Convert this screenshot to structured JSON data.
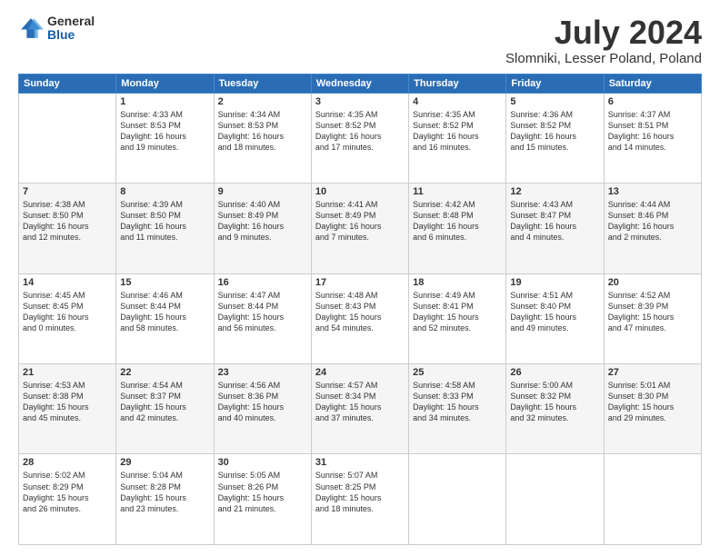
{
  "logo": {
    "general": "General",
    "blue": "Blue"
  },
  "title": "July 2024",
  "subtitle": "Slomniki, Lesser Poland, Poland",
  "days": [
    "Sunday",
    "Monday",
    "Tuesday",
    "Wednesday",
    "Thursday",
    "Friday",
    "Saturday"
  ],
  "weeks": [
    [
      {
        "num": "",
        "lines": []
      },
      {
        "num": "1",
        "lines": [
          "Sunrise: 4:33 AM",
          "Sunset: 8:53 PM",
          "Daylight: 16 hours",
          "and 19 minutes."
        ]
      },
      {
        "num": "2",
        "lines": [
          "Sunrise: 4:34 AM",
          "Sunset: 8:53 PM",
          "Daylight: 16 hours",
          "and 18 minutes."
        ]
      },
      {
        "num": "3",
        "lines": [
          "Sunrise: 4:35 AM",
          "Sunset: 8:52 PM",
          "Daylight: 16 hours",
          "and 17 minutes."
        ]
      },
      {
        "num": "4",
        "lines": [
          "Sunrise: 4:35 AM",
          "Sunset: 8:52 PM",
          "Daylight: 16 hours",
          "and 16 minutes."
        ]
      },
      {
        "num": "5",
        "lines": [
          "Sunrise: 4:36 AM",
          "Sunset: 8:52 PM",
          "Daylight: 16 hours",
          "and 15 minutes."
        ]
      },
      {
        "num": "6",
        "lines": [
          "Sunrise: 4:37 AM",
          "Sunset: 8:51 PM",
          "Daylight: 16 hours",
          "and 14 minutes."
        ]
      }
    ],
    [
      {
        "num": "7",
        "lines": [
          "Sunrise: 4:38 AM",
          "Sunset: 8:50 PM",
          "Daylight: 16 hours",
          "and 12 minutes."
        ]
      },
      {
        "num": "8",
        "lines": [
          "Sunrise: 4:39 AM",
          "Sunset: 8:50 PM",
          "Daylight: 16 hours",
          "and 11 minutes."
        ]
      },
      {
        "num": "9",
        "lines": [
          "Sunrise: 4:40 AM",
          "Sunset: 8:49 PM",
          "Daylight: 16 hours",
          "and 9 minutes."
        ]
      },
      {
        "num": "10",
        "lines": [
          "Sunrise: 4:41 AM",
          "Sunset: 8:49 PM",
          "Daylight: 16 hours",
          "and 7 minutes."
        ]
      },
      {
        "num": "11",
        "lines": [
          "Sunrise: 4:42 AM",
          "Sunset: 8:48 PM",
          "Daylight: 16 hours",
          "and 6 minutes."
        ]
      },
      {
        "num": "12",
        "lines": [
          "Sunrise: 4:43 AM",
          "Sunset: 8:47 PM",
          "Daylight: 16 hours",
          "and 4 minutes."
        ]
      },
      {
        "num": "13",
        "lines": [
          "Sunrise: 4:44 AM",
          "Sunset: 8:46 PM",
          "Daylight: 16 hours",
          "and 2 minutes."
        ]
      }
    ],
    [
      {
        "num": "14",
        "lines": [
          "Sunrise: 4:45 AM",
          "Sunset: 8:45 PM",
          "Daylight: 16 hours",
          "and 0 minutes."
        ]
      },
      {
        "num": "15",
        "lines": [
          "Sunrise: 4:46 AM",
          "Sunset: 8:44 PM",
          "Daylight: 15 hours",
          "and 58 minutes."
        ]
      },
      {
        "num": "16",
        "lines": [
          "Sunrise: 4:47 AM",
          "Sunset: 8:44 PM",
          "Daylight: 15 hours",
          "and 56 minutes."
        ]
      },
      {
        "num": "17",
        "lines": [
          "Sunrise: 4:48 AM",
          "Sunset: 8:43 PM",
          "Daylight: 15 hours",
          "and 54 minutes."
        ]
      },
      {
        "num": "18",
        "lines": [
          "Sunrise: 4:49 AM",
          "Sunset: 8:41 PM",
          "Daylight: 15 hours",
          "and 52 minutes."
        ]
      },
      {
        "num": "19",
        "lines": [
          "Sunrise: 4:51 AM",
          "Sunset: 8:40 PM",
          "Daylight: 15 hours",
          "and 49 minutes."
        ]
      },
      {
        "num": "20",
        "lines": [
          "Sunrise: 4:52 AM",
          "Sunset: 8:39 PM",
          "Daylight: 15 hours",
          "and 47 minutes."
        ]
      }
    ],
    [
      {
        "num": "21",
        "lines": [
          "Sunrise: 4:53 AM",
          "Sunset: 8:38 PM",
          "Daylight: 15 hours",
          "and 45 minutes."
        ]
      },
      {
        "num": "22",
        "lines": [
          "Sunrise: 4:54 AM",
          "Sunset: 8:37 PM",
          "Daylight: 15 hours",
          "and 42 minutes."
        ]
      },
      {
        "num": "23",
        "lines": [
          "Sunrise: 4:56 AM",
          "Sunset: 8:36 PM",
          "Daylight: 15 hours",
          "and 40 minutes."
        ]
      },
      {
        "num": "24",
        "lines": [
          "Sunrise: 4:57 AM",
          "Sunset: 8:34 PM",
          "Daylight: 15 hours",
          "and 37 minutes."
        ]
      },
      {
        "num": "25",
        "lines": [
          "Sunrise: 4:58 AM",
          "Sunset: 8:33 PM",
          "Daylight: 15 hours",
          "and 34 minutes."
        ]
      },
      {
        "num": "26",
        "lines": [
          "Sunrise: 5:00 AM",
          "Sunset: 8:32 PM",
          "Daylight: 15 hours",
          "and 32 minutes."
        ]
      },
      {
        "num": "27",
        "lines": [
          "Sunrise: 5:01 AM",
          "Sunset: 8:30 PM",
          "Daylight: 15 hours",
          "and 29 minutes."
        ]
      }
    ],
    [
      {
        "num": "28",
        "lines": [
          "Sunrise: 5:02 AM",
          "Sunset: 8:29 PM",
          "Daylight: 15 hours",
          "and 26 minutes."
        ]
      },
      {
        "num": "29",
        "lines": [
          "Sunrise: 5:04 AM",
          "Sunset: 8:28 PM",
          "Daylight: 15 hours",
          "and 23 minutes."
        ]
      },
      {
        "num": "30",
        "lines": [
          "Sunrise: 5:05 AM",
          "Sunset: 8:26 PM",
          "Daylight: 15 hours",
          "and 21 minutes."
        ]
      },
      {
        "num": "31",
        "lines": [
          "Sunrise: 5:07 AM",
          "Sunset: 8:25 PM",
          "Daylight: 15 hours",
          "and 18 minutes."
        ]
      },
      {
        "num": "",
        "lines": []
      },
      {
        "num": "",
        "lines": []
      },
      {
        "num": "",
        "lines": []
      }
    ]
  ]
}
